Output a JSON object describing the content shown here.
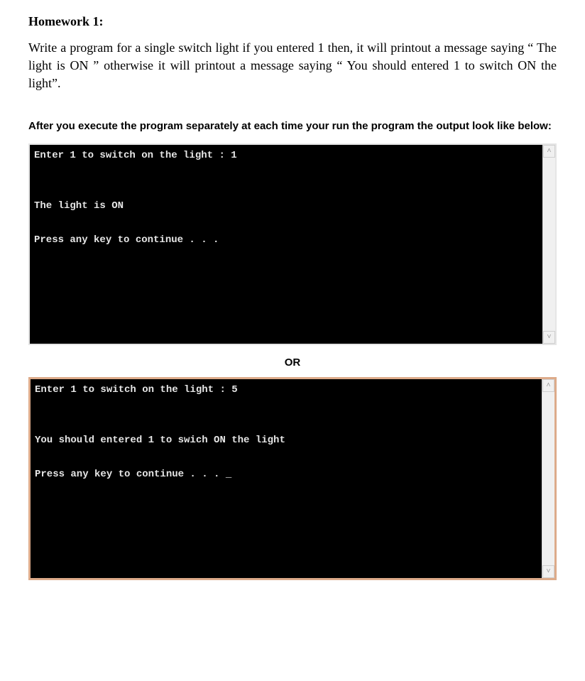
{
  "heading": "Homework 1:",
  "paragraph": "Write a program for a single switch light if you entered 1 then, it will printout a message saying “ The light is ON ” otherwise it will printout a message saying “ You should entered 1 to switch ON the light”.",
  "subheading": "After you execute the program separately at each time your run the program the output look like below:",
  "console1": {
    "line1": "Enter 1 to switch on the light : 1",
    "line2": "",
    "line3": "",
    "line4": "The light is ON",
    "line5": "",
    "line6": "Press any key to continue . . ."
  },
  "or_label": "OR",
  "console2": {
    "line1": "Enter 1 to switch on the light : 5",
    "line2": "",
    "line3": "",
    "line4": "You should entered 1 to swich ON the light",
    "line5": "",
    "line6": "Press any key to continue . . . _"
  },
  "scrollbar": {
    "up": "˄",
    "down": "˅"
  }
}
